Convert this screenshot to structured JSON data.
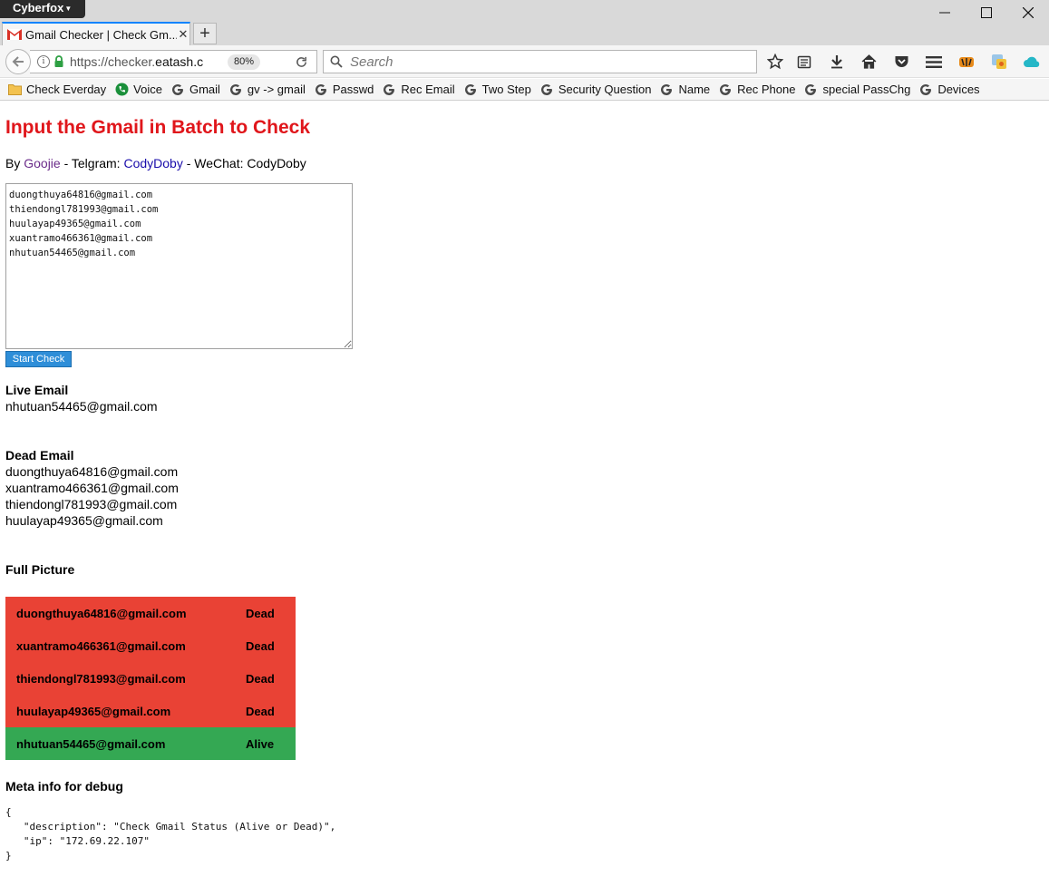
{
  "browser": {
    "app_name": "Cyberfox",
    "tab_title": "Gmail Checker | Check Gm...",
    "url_scheme": "https://checker.",
    "url_host": "eatash.c",
    "zoom": "80%",
    "search_placeholder": "Search",
    "window_controls": {
      "minimize": "—",
      "maximize": "☐",
      "close": "✕"
    }
  },
  "bookmarks": [
    {
      "label": "Check Everday",
      "icon": "folder-icon"
    },
    {
      "label": "Voice",
      "icon": "voice-icon"
    },
    {
      "label": "Gmail",
      "icon": "google-icon"
    },
    {
      "label": "gv -> gmail",
      "icon": "google-icon"
    },
    {
      "label": "Passwd",
      "icon": "google-icon"
    },
    {
      "label": "Rec Email",
      "icon": "google-icon"
    },
    {
      "label": "Two Step",
      "icon": "google-icon"
    },
    {
      "label": "Security Question",
      "icon": "google-icon"
    },
    {
      "label": "Name",
      "icon": "google-icon"
    },
    {
      "label": "Rec Phone",
      "icon": "google-icon"
    },
    {
      "label": "special PassChg",
      "icon": "google-icon"
    },
    {
      "label": "Devices",
      "icon": "google-icon"
    }
  ],
  "page": {
    "title": "Input the Gmail in Batch to Check",
    "byline": {
      "by": "By ",
      "author": "Goojie",
      "telegram_prefix": " - Telgram: ",
      "telegram": "CodyDoby",
      "wechat_prefix": " - WeChat: ",
      "wechat": "CodyDoby"
    },
    "input_emails": "duongthuya64816@gmail.com\nthiendongl781993@gmail.com\nhuulayap49365@gmail.com\nxuantramo466361@gmail.com\nnhutuan54465@gmail.com",
    "start_button": "Start Check",
    "live_heading": "Live Email",
    "live_emails": [
      "nhutuan54465@gmail.com"
    ],
    "dead_heading": "Dead Email",
    "dead_emails": [
      "duongthuya64816@gmail.com",
      "xuantramo466361@gmail.com",
      "thiendongl781993@gmail.com",
      "huulayap49365@gmail.com"
    ],
    "full_picture_heading": "Full Picture",
    "results": [
      {
        "email": "duongthuya64816@gmail.com",
        "status": "Dead"
      },
      {
        "email": "xuantramo466361@gmail.com",
        "status": "Dead"
      },
      {
        "email": "thiendongl781993@gmail.com",
        "status": "Dead"
      },
      {
        "email": "huulayap49365@gmail.com",
        "status": "Dead"
      },
      {
        "email": "nhutuan54465@gmail.com",
        "status": "Alive"
      }
    ],
    "colors": {
      "dead": "#e94235",
      "alive": "#34a853",
      "title": "#e0161b"
    },
    "debug_heading": "Meta info for debug",
    "debug_text": "{\n   \"description\": \"Check Gmail Status (Alive or Dead)\",\n   \"ip\": \"172.69.22.107\"\n}"
  }
}
